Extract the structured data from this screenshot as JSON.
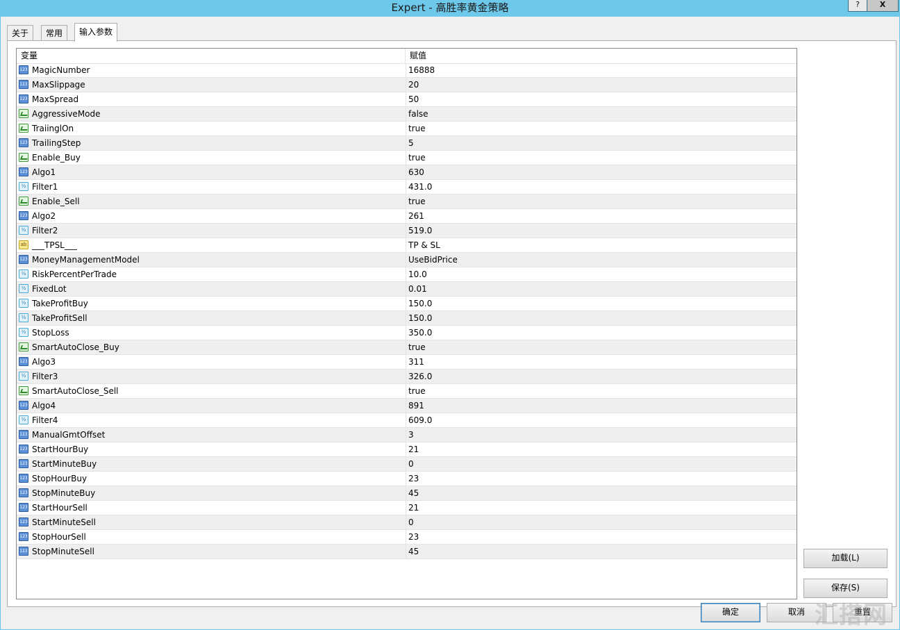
{
  "window": {
    "title": "Expert - 高胜率黄金策略",
    "help_label": "?",
    "close_label": "X"
  },
  "tabs": [
    {
      "label": "关于"
    },
    {
      "label": "常用"
    },
    {
      "label": "输入参数"
    }
  ],
  "grid": {
    "headers": {
      "variable": "变量",
      "value": "赋值"
    },
    "rows": [
      {
        "name": "MagicNumber",
        "value": "16888",
        "type": "int"
      },
      {
        "name": "MaxSlippage",
        "value": "20",
        "type": "int"
      },
      {
        "name": "MaxSpread",
        "value": "50",
        "type": "int"
      },
      {
        "name": "AggressiveMode",
        "value": "false",
        "type": "bool"
      },
      {
        "name": "TraiinglOn",
        "value": "true",
        "type": "bool"
      },
      {
        "name": "TrailingStep",
        "value": "5",
        "type": "int"
      },
      {
        "name": "Enable_Buy",
        "value": "true",
        "type": "bool"
      },
      {
        "name": "Algo1",
        "value": "630",
        "type": "int"
      },
      {
        "name": "Filter1",
        "value": "431.0",
        "type": "double"
      },
      {
        "name": "Enable_Sell",
        "value": "true",
        "type": "bool"
      },
      {
        "name": "Algo2",
        "value": "261",
        "type": "int"
      },
      {
        "name": "Filter2",
        "value": "519.0",
        "type": "double"
      },
      {
        "name": "___TPSL___",
        "value": "TP & SL",
        "type": "string"
      },
      {
        "name": "MoneyManagementModel",
        "value": "UseBidPrice",
        "type": "int"
      },
      {
        "name": "RiskPercentPerTrade",
        "value": "10.0",
        "type": "double"
      },
      {
        "name": "FixedLot",
        "value": "0.01",
        "type": "double"
      },
      {
        "name": "TakeProfitBuy",
        "value": "150.0",
        "type": "double"
      },
      {
        "name": "TakeProfitSell",
        "value": "150.0",
        "type": "double"
      },
      {
        "name": "StopLoss",
        "value": "350.0",
        "type": "double"
      },
      {
        "name": "SmartAutoClose_Buy",
        "value": "true",
        "type": "bool"
      },
      {
        "name": "Algo3",
        "value": "311",
        "type": "int"
      },
      {
        "name": "Filter3",
        "value": "326.0",
        "type": "double"
      },
      {
        "name": "SmartAutoClose_Sell",
        "value": "true",
        "type": "bool"
      },
      {
        "name": "Algo4",
        "value": "891",
        "type": "int"
      },
      {
        "name": "Filter4",
        "value": "609.0",
        "type": "double"
      },
      {
        "name": "ManualGmtOffset",
        "value": "3",
        "type": "int"
      },
      {
        "name": "StartHourBuy",
        "value": "21",
        "type": "int"
      },
      {
        "name": "StartMinuteBuy",
        "value": "0",
        "type": "int"
      },
      {
        "name": "StopHourBuy",
        "value": "23",
        "type": "int"
      },
      {
        "name": "StopMinuteBuy",
        "value": "45",
        "type": "int"
      },
      {
        "name": "StartHourSell",
        "value": "21",
        "type": "int"
      },
      {
        "name": "StartMinuteSell",
        "value": "0",
        "type": "int"
      },
      {
        "name": "StopHourSell",
        "value": "23",
        "type": "int"
      },
      {
        "name": "StopMinuteSell",
        "value": "45",
        "type": "int"
      }
    ]
  },
  "icons": {
    "int": {
      "name": "integer-type-icon",
      "glyph": "123"
    },
    "double": {
      "name": "double-type-icon",
      "glyph": "½"
    },
    "bool": {
      "name": "boolean-type-icon",
      "glyph": ""
    },
    "string": {
      "name": "string-type-icon",
      "glyph": "ab"
    }
  },
  "buttons": {
    "load": "加载(L)",
    "save": "保存(S)",
    "ok": "确定",
    "cancel": "取消",
    "reset": "重置"
  },
  "watermark": "汇搭网"
}
